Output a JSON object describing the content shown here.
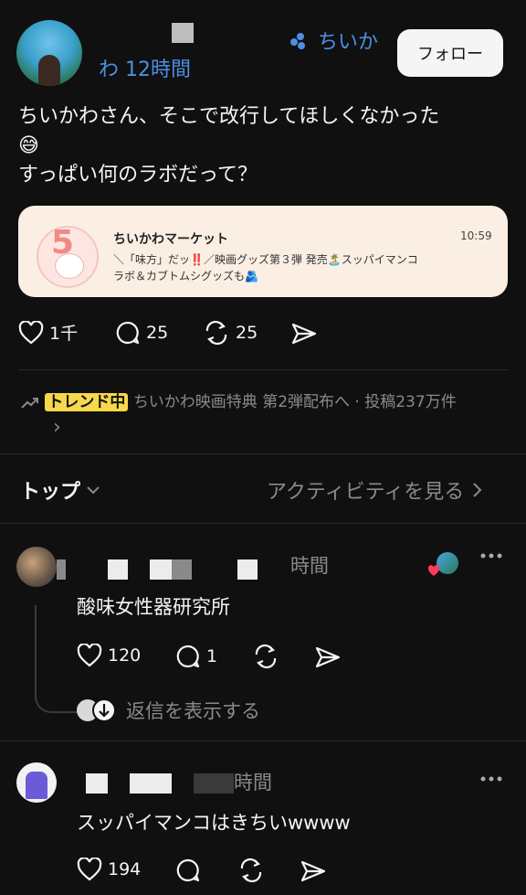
{
  "post": {
    "header_partial": "わ 12時間",
    "topic": "ちいか",
    "follow_label": "フォロー",
    "text_line1": "ちいかわさん、そこで改行してほしくなかった",
    "emoji": "😅",
    "text_line2": "すっぱい何のラボだって？",
    "embed": {
      "title": "ちいかわマーケット",
      "time": "10:59",
      "line1": "＼「味方」だッ‼️／映画グッズ第３弾 発売🏝️スッパイマンコ",
      "line2": "ラボ＆カブトムシグッズも🫂"
    },
    "likes": "1千",
    "replies": "25",
    "reposts": "25"
  },
  "trend": {
    "badge": "トレンド中",
    "text": "ちいかわ映画特典 第2弾配布へ · 投稿237万件",
    "chevron": "›"
  },
  "sort": {
    "top_label": "トップ",
    "activity_label": "アクティビティを見る"
  },
  "replies": [
    {
      "time_partial": "時間",
      "text": "酸味女性器研究所",
      "likes": "120",
      "replies": "1",
      "show_replies": "返信を表示する"
    },
    {
      "time_partial": "時間",
      "text": "スッパイマンコはきちいwwww",
      "likes": "194"
    }
  ],
  "colors": {
    "background": "#101010",
    "accent_blue": "#4a90e2",
    "embed_bg": "#fbefe3",
    "trend_badge": "#f7d84a"
  }
}
